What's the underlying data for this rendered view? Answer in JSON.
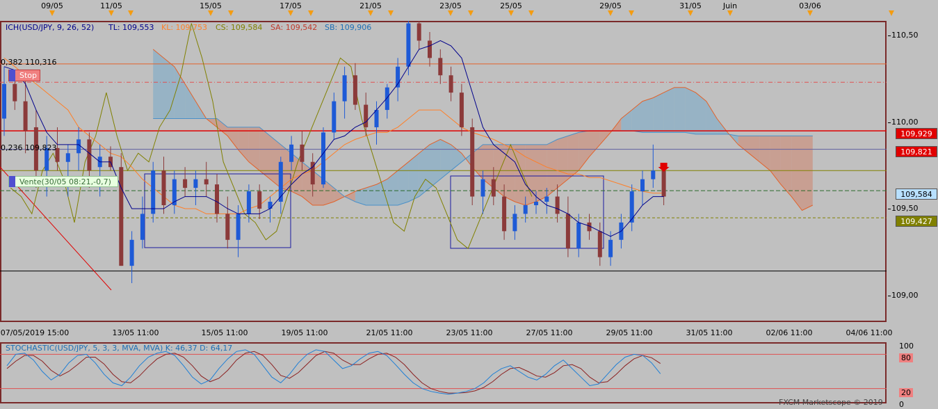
{
  "top_axis": {
    "labels": [
      "09/05",
      "11/05",
      "15/05",
      "17/05",
      "21/05",
      "23/05",
      "25/05",
      "29/05",
      "31/05",
      "Juin",
      "03/06"
    ]
  },
  "indicator_header": {
    "ich": "ICH(USD/JPY, 9, 26, 52)",
    "tl": "TL: 109,553",
    "kl": "KL: 109,753",
    "cs": "CS: 109,584",
    "sa": "SA: 109,542",
    "sb": "SB: 109,906"
  },
  "annotations": {
    "fib_382": "0,382 110,316",
    "fib_236": "0,236 109,823",
    "stop_label": "Stop",
    "vente_label": "Vente(30/05 08:21,-0,7)"
  },
  "right_scale": {
    "ticks": [
      "110,50",
      "110,00",
      "109,50",
      "109,00"
    ],
    "tags": [
      {
        "text": "109,929",
        "bg": "#e00000",
        "fg": "#ffffff"
      },
      {
        "text": "109,821",
        "bg": "#e00000",
        "fg": "#ffffff"
      },
      {
        "text": "109,584",
        "bg": "#b8e0ff",
        "fg": "#000000"
      },
      {
        "text": "109,427",
        "bg": "#808000",
        "fg": "#ffffff"
      }
    ]
  },
  "bottom_axis": {
    "labels": [
      "07/05/2019 15:00",
      "13/05 11:00",
      "15/05 11:00",
      "19/05 11:00",
      "21/05 11:00",
      "23/05 11:00",
      "27/05 11:00",
      "29/05 11:00",
      "31/05 11:00",
      "02/06 11:00",
      "04/06 11:00"
    ]
  },
  "stochastic": {
    "header": "STOCHASTIC(USD/JPY, 5, 3, 3, MVA, MVA)  K: 46,37   D: 64,17",
    "ticks": [
      "100",
      "80",
      "20",
      "0"
    ]
  },
  "watermark": "FXCM Marketscope © 2019",
  "colors": {
    "bull": "#1e5ad6",
    "bear": "#8b3a3a",
    "tenkan": "#00008b",
    "kijun": "#ff7f27",
    "chikou": "#808000",
    "cloud_bear": "#c9998a",
    "cloud_bull": "#8fb0c6"
  },
  "chart_data": {
    "type": "candlestick",
    "instrument": "USD/JPY",
    "ylim": [
      108.85,
      110.62
    ],
    "candles": [
      [
        110.0,
        110.3,
        109.9,
        110.2
      ],
      [
        110.2,
        110.28,
        110.05,
        110.1
      ],
      [
        110.1,
        110.22,
        109.8,
        109.93
      ],
      [
        109.95,
        110.05,
        109.6,
        109.7
      ],
      [
        109.7,
        109.9,
        109.55,
        109.83
      ],
      [
        109.83,
        109.95,
        109.7,
        109.75
      ],
      [
        109.75,
        109.85,
        109.55,
        109.8
      ],
      [
        109.8,
        109.95,
        109.7,
        109.88
      ],
      [
        109.88,
        109.92,
        109.6,
        109.7
      ],
      [
        109.72,
        109.85,
        109.55,
        109.78
      ],
      [
        109.78,
        109.84,
        109.7,
        109.72
      ],
      [
        109.72,
        109.8,
        109.15,
        109.15
      ],
      [
        109.15,
        109.35,
        109.05,
        109.3
      ],
      [
        109.3,
        109.55,
        109.25,
        109.45
      ],
      [
        109.45,
        109.75,
        109.4,
        109.7
      ],
      [
        109.7,
        109.78,
        109.45,
        109.5
      ],
      [
        109.5,
        109.7,
        109.45,
        109.65
      ],
      [
        109.65,
        109.72,
        109.55,
        109.6
      ],
      [
        109.6,
        109.7,
        109.5,
        109.65
      ],
      [
        109.65,
        109.75,
        109.55,
        109.62
      ],
      [
        109.62,
        109.68,
        109.4,
        109.45
      ],
      [
        109.45,
        109.55,
        109.25,
        109.3
      ],
      [
        109.3,
        109.5,
        109.2,
        109.45
      ],
      [
        109.45,
        109.62,
        109.4,
        109.58
      ],
      [
        109.58,
        109.62,
        109.42,
        109.48
      ],
      [
        109.48,
        109.55,
        109.4,
        109.52
      ],
      [
        109.52,
        109.78,
        109.45,
        109.75
      ],
      [
        109.75,
        109.9,
        109.7,
        109.85
      ],
      [
        109.85,
        109.93,
        109.7,
        109.75
      ],
      [
        109.75,
        109.8,
        109.55,
        109.62
      ],
      [
        109.62,
        109.95,
        109.6,
        109.92
      ],
      [
        109.92,
        110.15,
        109.88,
        110.1
      ],
      [
        110.1,
        110.3,
        110.0,
        110.25
      ],
      [
        110.25,
        110.32,
        110.05,
        110.08
      ],
      [
        110.08,
        110.15,
        109.9,
        109.95
      ],
      [
        109.95,
        110.1,
        109.85,
        110.05
      ],
      [
        110.05,
        110.2,
        110.0,
        110.18
      ],
      [
        110.18,
        110.35,
        110.1,
        110.3
      ],
      [
        110.3,
        110.62,
        110.25,
        110.55
      ],
      [
        110.55,
        110.58,
        110.4,
        110.45
      ],
      [
        110.45,
        110.5,
        110.3,
        110.35
      ],
      [
        110.35,
        110.4,
        110.2,
        110.25
      ],
      [
        110.25,
        110.3,
        110.1,
        110.15
      ],
      [
        110.15,
        110.2,
        109.9,
        109.95
      ],
      [
        109.95,
        110.0,
        109.5,
        109.55
      ],
      [
        109.55,
        109.7,
        109.45,
        109.65
      ],
      [
        109.65,
        109.72,
        109.5,
        109.55
      ],
      [
        109.55,
        109.62,
        109.3,
        109.35
      ],
      [
        109.35,
        109.5,
        109.3,
        109.45
      ],
      [
        109.45,
        109.55,
        109.4,
        109.5
      ],
      [
        109.5,
        109.58,
        109.45,
        109.52
      ],
      [
        109.52,
        109.6,
        109.45,
        109.55
      ],
      [
        109.55,
        109.62,
        109.4,
        109.45
      ],
      [
        109.45,
        109.55,
        109.2,
        109.25
      ],
      [
        109.25,
        109.45,
        109.2,
        109.4
      ],
      [
        109.4,
        109.45,
        109.3,
        109.35
      ],
      [
        109.35,
        109.4,
        109.15,
        109.2
      ],
      [
        109.2,
        109.35,
        109.15,
        109.3
      ],
      [
        109.3,
        109.45,
        109.25,
        109.4
      ],
      [
        109.4,
        109.62,
        109.35,
        109.58
      ],
      [
        109.58,
        109.7,
        109.5,
        109.65
      ],
      [
        109.65,
        109.85,
        109.6,
        109.7
      ],
      [
        109.7,
        109.72,
        109.5,
        109.55
      ]
    ],
    "tenkan_sen": [
      110.3,
      110.28,
      110.2,
      110.05,
      109.92,
      109.85,
      109.85,
      109.85,
      109.8,
      109.75,
      109.75,
      109.6,
      109.48,
      109.48,
      109.48,
      109.48,
      109.52,
      109.55,
      109.55,
      109.55,
      109.52,
      109.48,
      109.45,
      109.45,
      109.45,
      109.48,
      109.55,
      109.62,
      109.68,
      109.72,
      109.8,
      109.88,
      109.9,
      109.95,
      109.98,
      110.05,
      110.12,
      110.2,
      110.3,
      110.4,
      110.42,
      110.45,
      110.42,
      110.35,
      110.15,
      109.95,
      109.85,
      109.8,
      109.75,
      109.62,
      109.55,
      109.5,
      109.48,
      109.45,
      109.4,
      109.38,
      109.35,
      109.32,
      109.35,
      109.42,
      109.5,
      109.55,
      109.55
    ],
    "kijun_sen": [
      110.35,
      110.3,
      110.25,
      110.2,
      110.15,
      110.1,
      110.05,
      109.95,
      109.9,
      109.85,
      109.8,
      109.78,
      109.72,
      109.65,
      109.6,
      109.55,
      109.5,
      109.48,
      109.48,
      109.45,
      109.45,
      109.45,
      109.45,
      109.48,
      109.5,
      109.55,
      109.6,
      109.65,
      109.68,
      109.7,
      109.75,
      109.8,
      109.85,
      109.88,
      109.9,
      109.92,
      109.92,
      109.95,
      110.0,
      110.05,
      110.05,
      110.05,
      110.0,
      109.95,
      109.92,
      109.9,
      109.88,
      109.85,
      109.82,
      109.78,
      109.75,
      109.72,
      109.7,
      109.68,
      109.68,
      109.66,
      109.66,
      109.64,
      109.62,
      109.6,
      109.58,
      109.57,
      109.57
    ],
    "cloud_span_a": [
      110.4,
      110.35,
      110.3,
      110.2,
      110.1,
      110.0,
      109.95,
      109.9,
      109.82,
      109.75,
      109.7,
      109.65,
      109.6,
      109.58,
      109.55,
      109.5,
      109.5,
      109.52,
      109.55,
      109.58,
      109.6,
      109.62,
      109.65,
      109.7,
      109.75,
      109.8,
      109.85,
      109.88,
      109.85,
      109.8,
      109.72,
      109.65,
      109.6,
      109.55,
      109.52,
      109.5,
      109.52,
      109.55,
      109.6,
      109.65,
      109.7,
      109.78,
      109.85,
      109.92,
      110.0,
      110.05,
      110.1,
      110.12,
      110.15,
      110.18,
      110.18,
      110.15,
      110.1,
      110.0,
      109.92,
      109.85,
      109.8,
      109.75,
      109.7,
      109.62,
      109.55,
      109.47,
      109.5
    ],
    "cloud_span_b": [
      110.0,
      110.0,
      110.0,
      110.0,
      110.0,
      110.0,
      110.0,
      109.95,
      109.95,
      109.95,
      109.95,
      109.9,
      109.85,
      109.8,
      109.75,
      109.7,
      109.65,
      109.6,
      109.55,
      109.52,
      109.5,
      109.5,
      109.5,
      109.5,
      109.52,
      109.55,
      109.6,
      109.65,
      109.7,
      109.75,
      109.8,
      109.85,
      109.85,
      109.85,
      109.85,
      109.85,
      109.85,
      109.85,
      109.88,
      109.9,
      109.92,
      109.93,
      109.93,
      109.93,
      109.93,
      109.93,
      109.92,
      109.92,
      109.92,
      109.92,
      109.92,
      109.91,
      109.91,
      109.91,
      109.91,
      109.9,
      109.9,
      109.9,
      109.9,
      109.9,
      109.9,
      109.9,
      109.9
    ],
    "chikou_span": [
      109.6,
      109.55,
      109.45,
      109.7,
      109.8,
      109.65,
      109.4,
      109.75,
      109.9,
      110.15,
      109.9,
      109.7,
      109.8,
      109.75,
      109.95,
      110.05,
      110.25,
      110.55,
      110.35,
      110.1,
      109.75,
      109.6,
      109.45,
      109.4,
      109.3,
      109.35,
      109.55,
      109.75,
      109.9,
      110.05,
      110.2,
      110.35,
      110.3,
      110.0,
      109.8,
      109.6,
      109.4,
      109.35,
      109.55,
      109.65,
      109.6,
      109.45,
      109.3,
      109.25,
      109.4,
      109.55,
      109.7,
      109.85,
      109.7,
      109.55
    ],
    "levels": {
      "fib_382": 110.316,
      "fib_236": 109.823,
      "stop": 110.21,
      "resistance": 109.929,
      "sell": 109.7,
      "tl": 109.584,
      "support": 109.427,
      "low_line": 109.12
    },
    "stochastic_k": [
      60,
      80,
      82,
      70,
      50,
      35,
      45,
      65,
      78,
      80,
      65,
      45,
      30,
      25,
      40,
      60,
      75,
      82,
      85,
      78,
      60,
      40,
      28,
      35,
      55,
      72,
      85,
      88,
      80,
      60,
      40,
      30,
      45,
      65,
      80,
      88,
      85,
      70,
      55,
      60,
      72,
      82,
      85,
      78,
      62,
      45,
      30,
      20,
      15,
      12,
      10,
      12,
      15,
      20,
      30,
      45,
      55,
      60,
      50,
      40,
      35,
      45,
      60,
      70,
      55,
      40,
      25,
      28,
      45,
      62,
      75,
      80,
      78,
      65,
      46
    ],
    "stochastic_d": [
      55,
      68,
      78,
      78,
      68,
      52,
      42,
      50,
      62,
      75,
      75,
      63,
      45,
      32,
      30,
      42,
      58,
      72,
      80,
      82,
      75,
      60,
      42,
      32,
      38,
      52,
      70,
      82,
      85,
      78,
      62,
      43,
      38,
      48,
      63,
      78,
      85,
      82,
      70,
      62,
      62,
      72,
      80,
      82,
      75,
      62,
      45,
      30,
      20,
      15,
      12,
      12,
      13,
      16,
      22,
      32,
      45,
      55,
      57,
      50,
      42,
      40,
      48,
      60,
      62,
      55,
      40,
      30,
      32,
      45,
      60,
      72,
      78,
      74,
      64
    ]
  }
}
